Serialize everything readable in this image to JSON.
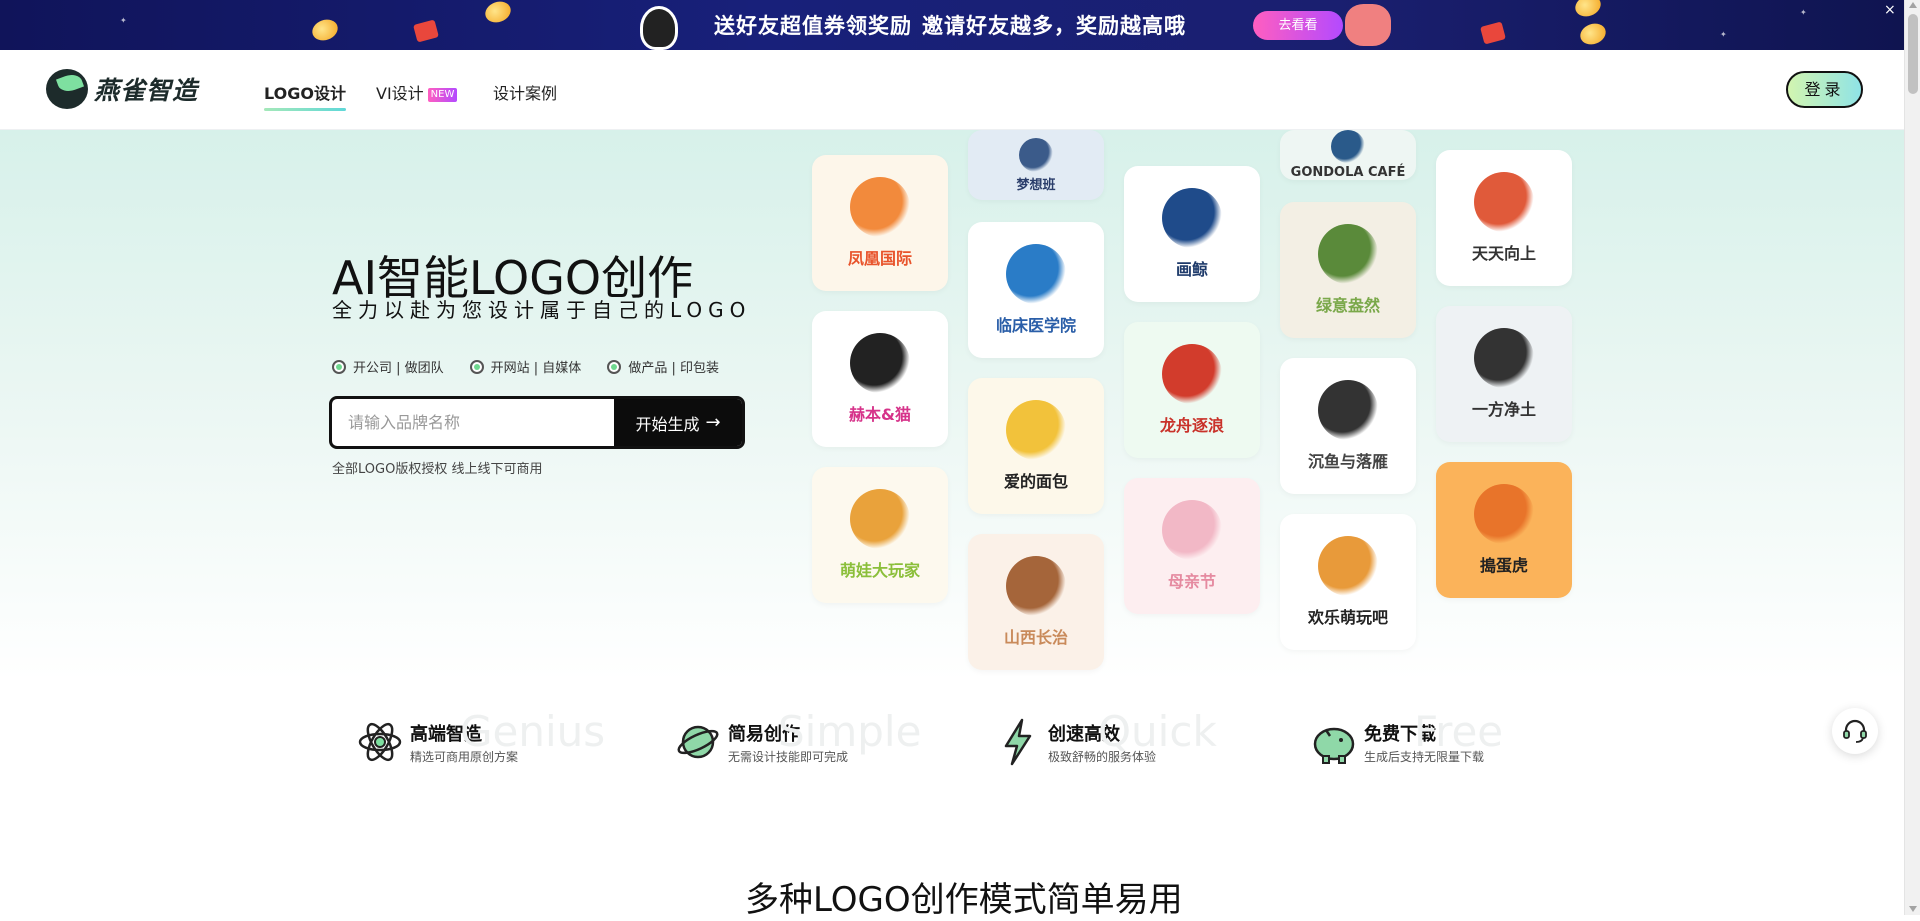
{
  "banner": {
    "text_1": "送好友超值券领奖励",
    "text_2": "邀请好友越多，奖励越高哦",
    "button_label": "去看看",
    "close_label": "×"
  },
  "nav": {
    "brand": "燕雀智造",
    "items": [
      {
        "label": "LOGO设计",
        "active": true
      },
      {
        "label": "VI设计",
        "badge": "NEW"
      },
      {
        "label": "设计案例"
      }
    ],
    "login_label": "登录"
  },
  "hero": {
    "title": "AI智能LOGO创作",
    "subtitle": "全力以赴为您设计属于自己的LOGO",
    "options": [
      "开公司 | 做团队",
      "开网站 | 自媒体",
      "做产品 | 印包装"
    ],
    "search_placeholder": "请输入品牌名称",
    "search_button": "开始生成",
    "note": "全部LOGO版权授权 线上线下可商用"
  },
  "logo_cards": [
    {
      "name": "凤凰国际",
      "color": "#e8532b",
      "bg": "#fdf6ea",
      "art": "#f28a3c"
    },
    {
      "name": "赫本&猫",
      "color": "#d6338a",
      "bg": "#ffffff",
      "art": "#222222"
    },
    {
      "name": "萌娃大玩家",
      "color": "#8bbf3a",
      "bg": "#fdf9ee",
      "art": "#e9a23b"
    },
    {
      "name": "梦想班",
      "color": "#2b3e6b",
      "bg": "#e2ebf4",
      "art": "#3b5b8a"
    },
    {
      "name": "临床医学院",
      "color": "#2a5ea8",
      "bg": "#ffffff",
      "art": "#2a7cc7"
    },
    {
      "name": "爱的面包",
      "color": "#222222",
      "bg": "#fdf8ea",
      "art": "#f2c23b"
    },
    {
      "name": "山西长治",
      "color": "#c98a5a",
      "bg": "#fbf1e8",
      "art": "#a5653a"
    },
    {
      "name": "画鲸",
      "color": "#1f3b6b",
      "bg": "#ffffff",
      "art": "#1f4b8a"
    },
    {
      "name": "龙舟逐浪",
      "color": "#c9322a",
      "bg": "#eefaf1",
      "art": "#d23c2c"
    },
    {
      "name": "母亲节",
      "color": "#e58aa0",
      "bg": "#fdeef0",
      "art": "#f2b8c6"
    },
    {
      "name": "GONDOLA CAFÉ",
      "color": "#333333",
      "bg": "#eef6f3",
      "art": "#2a5a8a"
    },
    {
      "name": "绿意盎然",
      "color": "#7aa84a",
      "bg": "#f3efe4",
      "art": "#5a8a3a"
    },
    {
      "name": "沉鱼与落雁",
      "color": "#444444",
      "bg": "#ffffff",
      "art": "#333333"
    },
    {
      "name": "欢乐萌玩吧",
      "color": "#222222",
      "bg": "#ffffff",
      "art": "#e89a3a"
    },
    {
      "name": "天天向上",
      "color": "#333333",
      "bg": "#ffffff",
      "art": "#e05a3a"
    },
    {
      "name": "一方净土",
      "color": "#333333",
      "bg": "#eef2f4",
      "art": "#333333"
    },
    {
      "name": "搗蛋虎",
      "color": "#222222",
      "bg": "#fbb35a",
      "art": "#e8742a"
    }
  ],
  "features": [
    {
      "title": "高端智造",
      "desc": "精选可商用原创方案",
      "ghost": "Genius",
      "icon": "atom-icon"
    },
    {
      "title": "简易创作",
      "desc": "无需设计技能即可完成",
      "ghost": "Simple",
      "icon": "planet-icon"
    },
    {
      "title": "创速高效",
      "desc": "极致舒畅的服务体验",
      "ghost": "Quick",
      "icon": "lightning-icon"
    },
    {
      "title": "免费下载",
      "desc": "生成后支持无限量下载",
      "ghost": "Free",
      "icon": "piggy-bank-icon"
    }
  ],
  "section_title": "多种LOGO创作模式简单易用"
}
